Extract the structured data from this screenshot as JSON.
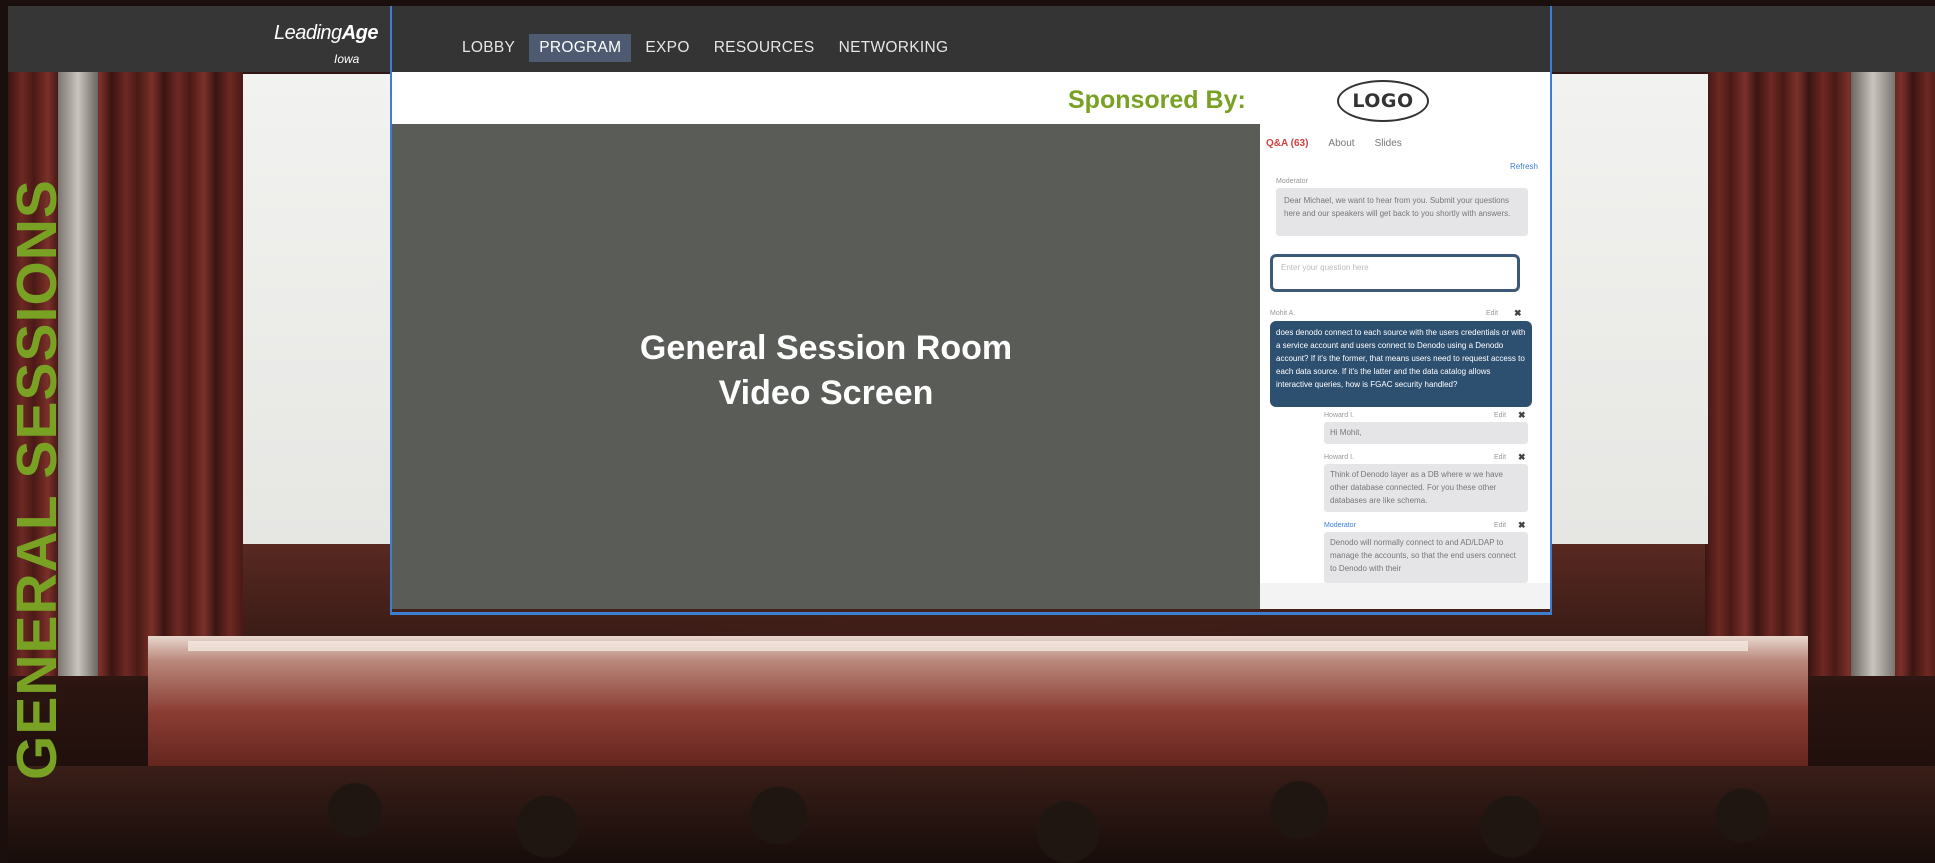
{
  "section_title": "GENERAL SESSIONS",
  "logo": {
    "brand_prefix": "Leading",
    "brand_bold": "Age",
    "sub": "Iowa"
  },
  "nav": {
    "items": [
      {
        "label": "LOBBY",
        "active": false
      },
      {
        "label": "PROGRAM",
        "active": true
      },
      {
        "label": "EXPO",
        "active": false
      },
      {
        "label": "RESOURCES",
        "active": false
      },
      {
        "label": "NETWORKING",
        "active": false
      }
    ]
  },
  "sponsor": {
    "label": "Sponsored By:",
    "logo_text": "LOGO"
  },
  "video": {
    "line1": "General Session Room",
    "line2": "Video Screen"
  },
  "qa": {
    "tabs": [
      "Q&A (63)",
      "About",
      "Slides"
    ],
    "refresh": "Refresh",
    "moderator_meta": "Moderator",
    "welcome": "Dear Michael, we want to hear from you. Submit your questions here and our speakers will get back to you shortly with answers.",
    "input_placeholder": "Enter your question here",
    "question_meta": "Mohit A.",
    "question_meta_right": "Edit",
    "question": "does denodo connect to each source with the users credentials or with a service account and users connect to Denodo using a Denodo account? If it's the former, that means users need to request access to each data source. If it's the latter and the data catalog allows interactive queries, how is FGAC security handled?",
    "replies": [
      {
        "meta": "Howard I.",
        "meta_right": "Edit",
        "text": "Hi Mohit,"
      },
      {
        "meta": "Howard I.",
        "meta_right": "Edit",
        "text": "Think of Denodo layer as a DB where w we have other database connected. For you these other databases are like schema."
      },
      {
        "meta": "Moderator",
        "meta_right": "Edit",
        "text": "Denodo will normally connect to and AD/LDAP to manage the accounts, so that the end users connect to Denodo with their"
      }
    ]
  },
  "colors": {
    "accent_green": "#79a124",
    "nav_active": "#4e5a70",
    "panel_border": "#3b7fd0"
  }
}
